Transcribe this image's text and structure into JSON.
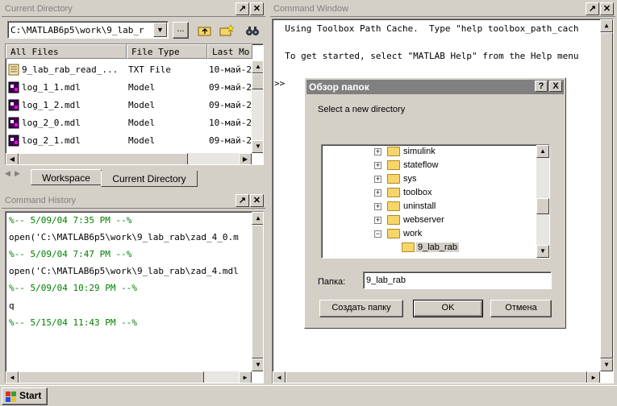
{
  "current_directory": {
    "title": "Current Directory",
    "path": "C:\\MATLAB6p5\\work\\9_lab_r",
    "browse_label": "...",
    "columns": [
      "All Files",
      "File Type",
      "Last Mo"
    ],
    "files": [
      {
        "name": "9_lab_rab_read_...",
        "type": "TXT File",
        "date": "10-май-2"
      },
      {
        "name": "log_1_1.mdl",
        "type": "Model",
        "date": "09-май-2"
      },
      {
        "name": "log_1_2.mdl",
        "type": "Model",
        "date": "09-май-2"
      },
      {
        "name": "log_2_0.mdl",
        "type": "Model",
        "date": "10-май-2"
      },
      {
        "name": "log_2_1.mdl",
        "type": "Model",
        "date": "09-май-2"
      }
    ],
    "tabs": [
      "Workspace",
      "Current Directory"
    ]
  },
  "command_history": {
    "title": "Command History",
    "lines": [
      {
        "text": "%-- 5/09/04  7:35 PM --%",
        "kind": "comment"
      },
      {
        "text": "open('C:\\MATLAB6p5\\work\\9_lab_rab\\zad_4_0.m",
        "kind": "cmd"
      },
      {
        "text": "%-- 5/09/04  7:47 PM --%",
        "kind": "comment"
      },
      {
        "text": "open('C:\\MATLAB6p5\\work\\9_lab_rab\\zad_4.mdl",
        "kind": "cmd"
      },
      {
        "text": "%-- 5/09/04 10:29 PM --%",
        "kind": "comment"
      },
      {
        "text": "q",
        "kind": "cmd"
      },
      {
        "text": "%-- 5/15/04 11:43 PM --%",
        "kind": "comment"
      }
    ]
  },
  "command_window": {
    "title": "Command Window",
    "line1": "  Using Toolbox Path Cache.  Type \"help toolbox_path_cach",
    "line2": "  To get started, select \"MATLAB Help\" from the Help menu",
    "prompt": ">>"
  },
  "dialog": {
    "title": "Обзор папок",
    "help_btn": "?",
    "close_btn": "X",
    "prompt": "Select a new directory",
    "tree": [
      {
        "label": "simulink",
        "expander": "+"
      },
      {
        "label": "stateflow",
        "expander": "+"
      },
      {
        "label": "sys",
        "expander": "+"
      },
      {
        "label": "toolbox",
        "expander": "+"
      },
      {
        "label": "uninstall",
        "expander": "+"
      },
      {
        "label": "webserver",
        "expander": "+"
      },
      {
        "label": "work",
        "expander": "−"
      },
      {
        "label": "9_lab_rab",
        "expander": ""
      }
    ],
    "folder_label": "Папка:",
    "folder_value": "9_lab_rab",
    "create_btn": "Создать папку",
    "ok_btn": "OK",
    "cancel_btn": "Отмена"
  },
  "taskbar": {
    "start_label": "Start"
  }
}
